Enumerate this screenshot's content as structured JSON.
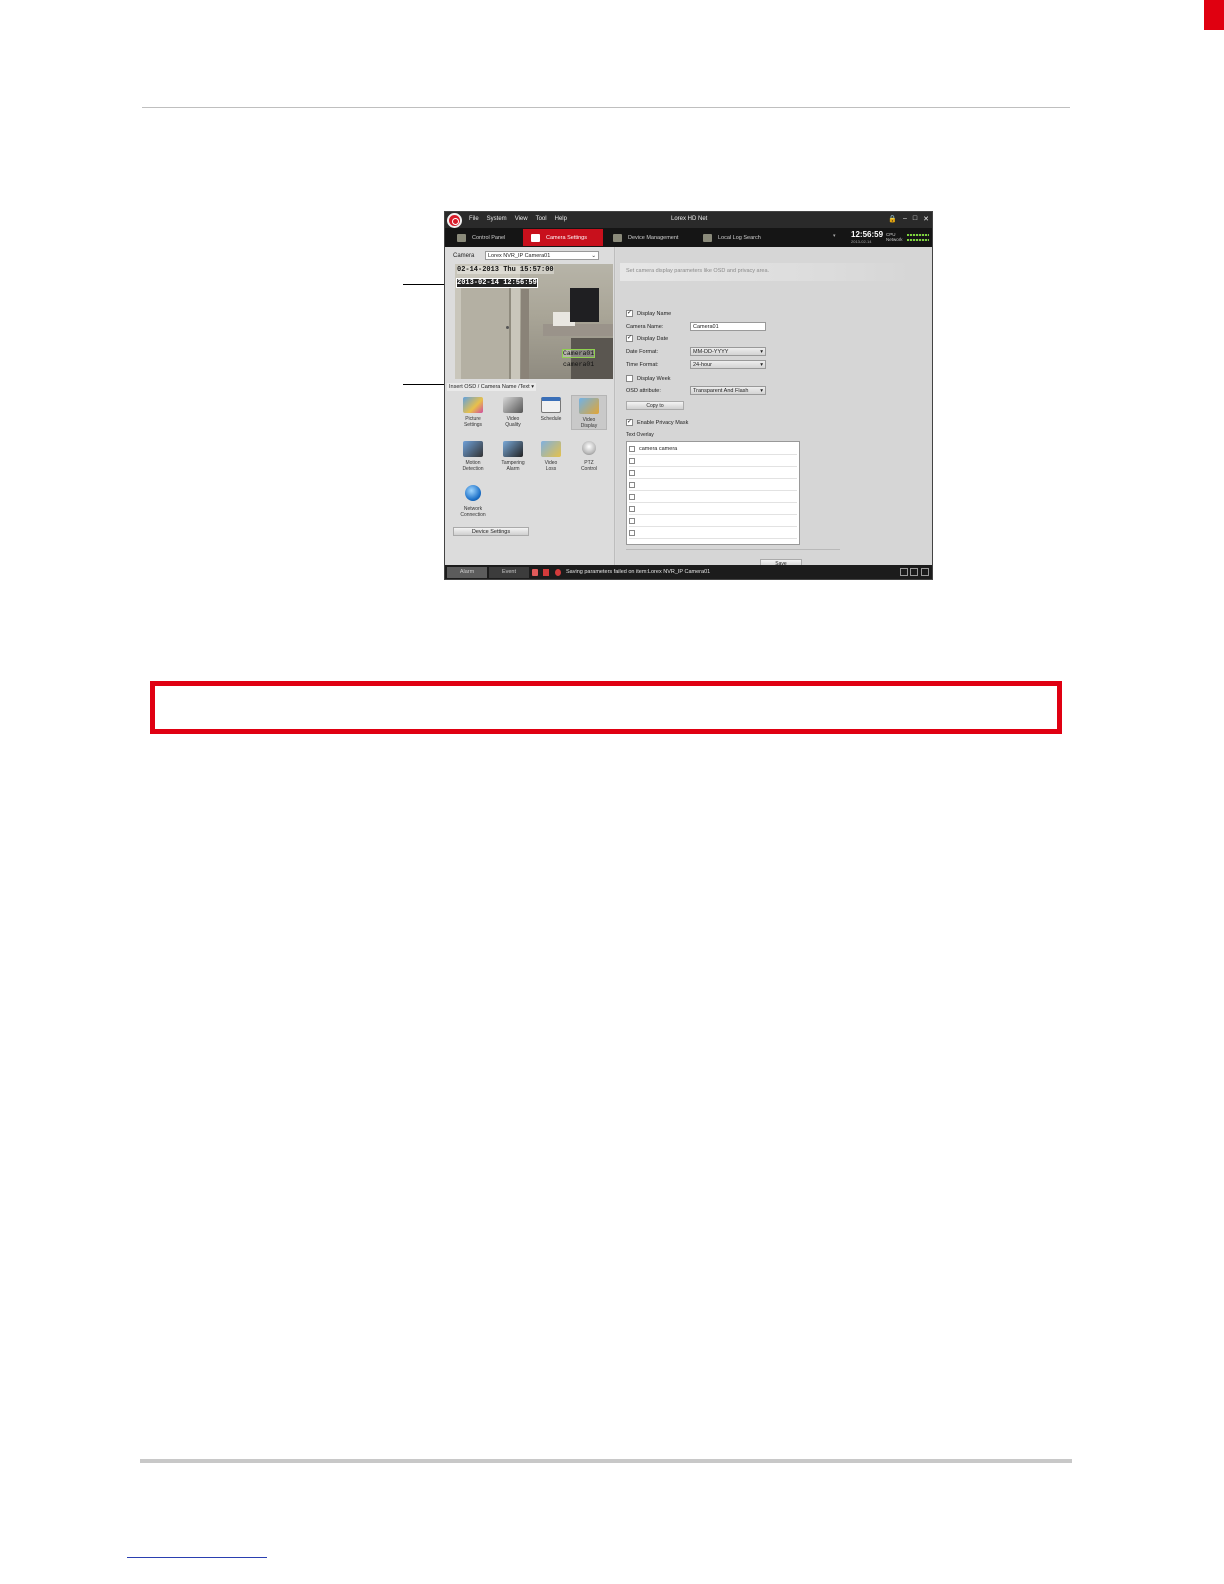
{
  "app": {
    "window_title": "Lorex HD Net",
    "menu": [
      "File",
      "System",
      "View",
      "Tool",
      "Help"
    ],
    "window_controls": [
      "🔒",
      "–",
      "□",
      "✕"
    ]
  },
  "tabs": [
    {
      "label": "Control Panel",
      "active": false
    },
    {
      "label": "Camera Settings",
      "active": true
    },
    {
      "label": "Device Management",
      "active": false
    },
    {
      "label": "Local Log Search",
      "active": false
    }
  ],
  "status_clock": {
    "time": "12:56:59",
    "date": "2013-02-14",
    "cpu_label": "CPU",
    "network_label": "Network"
  },
  "camera": {
    "label": "Camera",
    "selected": "Lorex NVR_IP Camera01"
  },
  "preview_osd": {
    "line1": "02-14-2013 Thu 15:57:00",
    "line2": "2013-02-14 12:56:59",
    "name_box": "Camera01",
    "name_text": "camera01"
  },
  "insert_osd": "Insert OSD / Camera Name /Text",
  "function_icons": [
    {
      "label_1": "Picture",
      "label_2": "Settings",
      "icon": "picture-settings-icon"
    },
    {
      "label_1": "Video",
      "label_2": "Quality",
      "icon": "video-quality-icon"
    },
    {
      "label_1": "Schedule",
      "label_2": "",
      "icon": "schedule-icon"
    },
    {
      "label_1": "Video",
      "label_2": "Display",
      "icon": "video-display-icon"
    },
    {
      "label_1": "Motion",
      "label_2": "Detection",
      "icon": "motion-detection-icon"
    },
    {
      "label_1": "Tampering",
      "label_2": "Alarm",
      "icon": "tampering-alarm-icon"
    },
    {
      "label_1": "Video",
      "label_2": "Loss",
      "icon": "video-loss-icon"
    },
    {
      "label_1": "PTZ",
      "label_2": "Control",
      "icon": "ptz-control-icon"
    },
    {
      "label_1": "Network",
      "label_2": "Connection",
      "icon": "network-connection-icon"
    }
  ],
  "device_settings_label": "Device Settings",
  "right_panel": {
    "banner": "Set camera display parameters like OSD and privacy area.",
    "display_name": {
      "label": "Display Name",
      "checked": true
    },
    "camera_name": {
      "label": "Camera Name:",
      "value": "Camera01"
    },
    "display_date": {
      "label": "Display Date",
      "checked": true
    },
    "date_format": {
      "label": "Date Format:",
      "value": "MM-DD-YYYY"
    },
    "time_format": {
      "label": "Time Format:",
      "value": "24-hour"
    },
    "display_week": {
      "label": "Display Week",
      "checked": false
    },
    "osd_attribute": {
      "label": "OSD attribute:",
      "value": "Transparent And Flash"
    },
    "copy_to": "Copy to",
    "enable_privacy_mask": {
      "label": "Enable Privacy Mask",
      "checked": true
    },
    "text_overlay_title": "Text Overlay",
    "text_overlay_rows": [
      "camera camera",
      "",
      "",
      "",
      "",
      "",
      "",
      ""
    ],
    "save": "Save"
  },
  "status_bar": {
    "tabs": [
      "Alarm",
      "Event"
    ],
    "message": "Saving parameters failed on item:Lorex NVR_IP Camera01"
  }
}
